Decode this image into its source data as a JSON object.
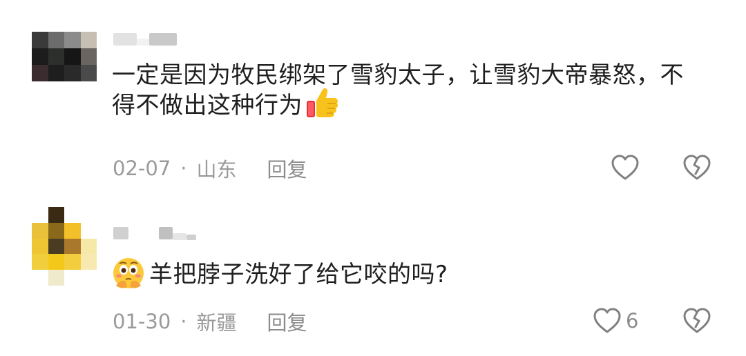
{
  "comments": [
    {
      "text": "一定是因为牧民绑架了雪豹太子，让雪豹大帝暴怒，不得不做出这种行为",
      "emoji": "thumbs-up-icon",
      "date": "02-07",
      "separator": "·",
      "location": "山东",
      "reply_label": "回复",
      "like_count": ""
    },
    {
      "text": "羊把脖子洗好了给它咬的吗?",
      "emoji": "thinking-face-icon",
      "date": "01-30",
      "separator": "·",
      "location": "新疆",
      "reply_label": "回复",
      "like_count": "6"
    }
  ],
  "colors": {
    "text": "#1f1f1f",
    "meta": "#9a9a9a",
    "icon": "#808080"
  }
}
